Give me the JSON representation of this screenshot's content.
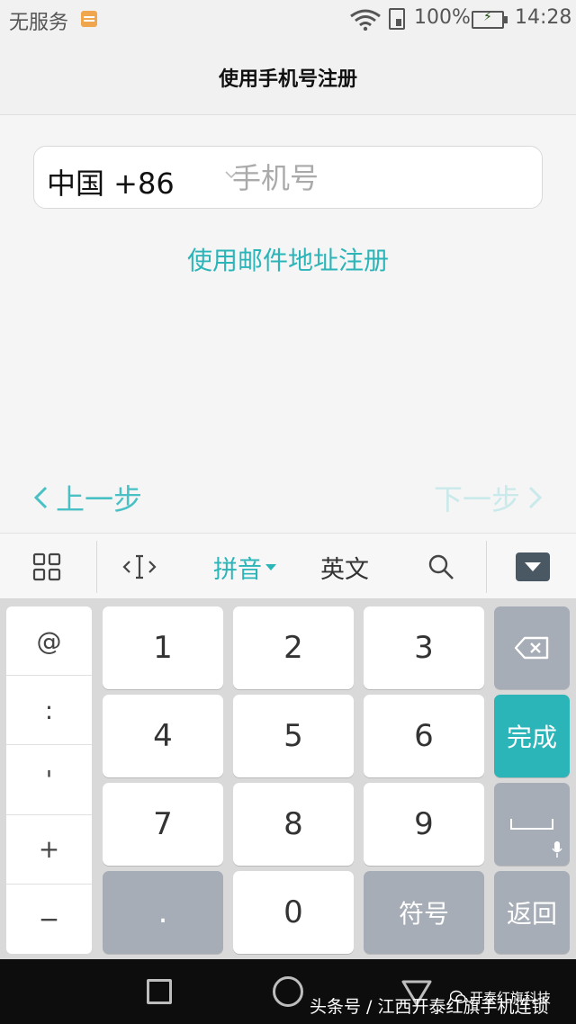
{
  "status_bar": {
    "carrier": "无服务",
    "battery_percent": "100%",
    "battery_level": 1.0,
    "time": "14:28"
  },
  "header": {
    "title": "使用手机号注册"
  },
  "form": {
    "country_code": "中国 +86",
    "phone_placeholder": "手机号",
    "phone_value": "",
    "email_register_link": "使用邮件地址注册"
  },
  "navigation": {
    "prev_label": "上一步",
    "next_label": "下一步"
  },
  "keyboard_toolbar": {
    "pinyin_label": "拼音",
    "english_label": "英文",
    "active_mode": "pinyin"
  },
  "keyboard": {
    "symbols": [
      "@",
      ":",
      "'",
      "+",
      "−"
    ],
    "digits": [
      "1",
      "2",
      "3",
      "4",
      "5",
      "6",
      "7",
      "8",
      "9",
      "0"
    ],
    "dot": ".",
    "symbol_key": "符号",
    "done_key": "完成",
    "return_key": "返回"
  },
  "watermark": {
    "brand": "开泰红旗科技",
    "line": "头条号 / 江西开泰红旗手机连锁"
  },
  "colors": {
    "accent": "#2bb5b8",
    "accent_disabled": "#c9e9ea",
    "key_gray": "#a6adb6",
    "battery_green": "#4cc32c"
  }
}
